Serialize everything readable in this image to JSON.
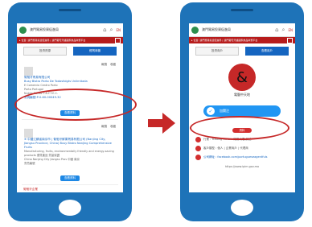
{
  "left": {
    "site_name": "澳門貿易投資促進局",
    "lang": "EN",
    "nav_text": "▸ 位置: 澳門貿易投資促進局 | 澳門葡萄牙語國家產品商貿平台",
    "tabs": [
      "投資資源",
      "經貿商機"
    ],
    "card1": {
      "actions": [
        "報價",
        "收藏"
      ],
      "title1": "葡萄牙貿易有限公司",
      "title2": "Busy Bistro Porto De Todasfolgts Unlimitada",
      "lines": [
        "E Comercio Centro Porto",
        "Porto Portugal",
        "Nubes Zonas C.A.F.T.E.C."
      ],
      "id_line": "會員編號:P-0-60-00049-32",
      "button": "查看資料"
    },
    "card2": {
      "actions": [
        "報價",
        "收藏"
      ],
      "title": "※ 中國江蘇省南京市 | 葡萄牙鮮果貿易有限公司 (Nanjing City, Jiangsu Province, China) Busy Bistro Nanjing Comprehensive Fruits",
      "lines": [
        "Manufacturing, fruits, environmentally friendly and energy-saving products 優質產品 質量保證",
        "China Nanjing City Jiangsu Prov 中國 南京",
        "會員編號"
      ],
      "button": "查看資料"
    },
    "bottom_text": "葡萄牙企業"
  },
  "right": {
    "site_name": "澳門貿易投資促進局",
    "lang": "EN",
    "nav_text": "▸ 位置: 澳門貿易投資促進局 | 澳門葡萄牙語國家產品商貿平台",
    "tabs": [
      "投資商戶",
      "查看用戶"
    ],
    "seal_glyph": "&",
    "seal_caption": "電腦中天地",
    "follow_label": "加関注",
    "section": "資料",
    "info_rows": [
      "行業 : Trading Others 貿易代理 其他",
      "客戶類型 : 個人 | 企業商戶 | 代理商",
      "公司網址 : facebook.com/portugueseagentfuls"
    ],
    "footer": "https://www.ipim.gov.mo"
  },
  "colors": {
    "phone": "#1e73b8",
    "highlight": "#c62828",
    "accent": "#1e88e5"
  }
}
